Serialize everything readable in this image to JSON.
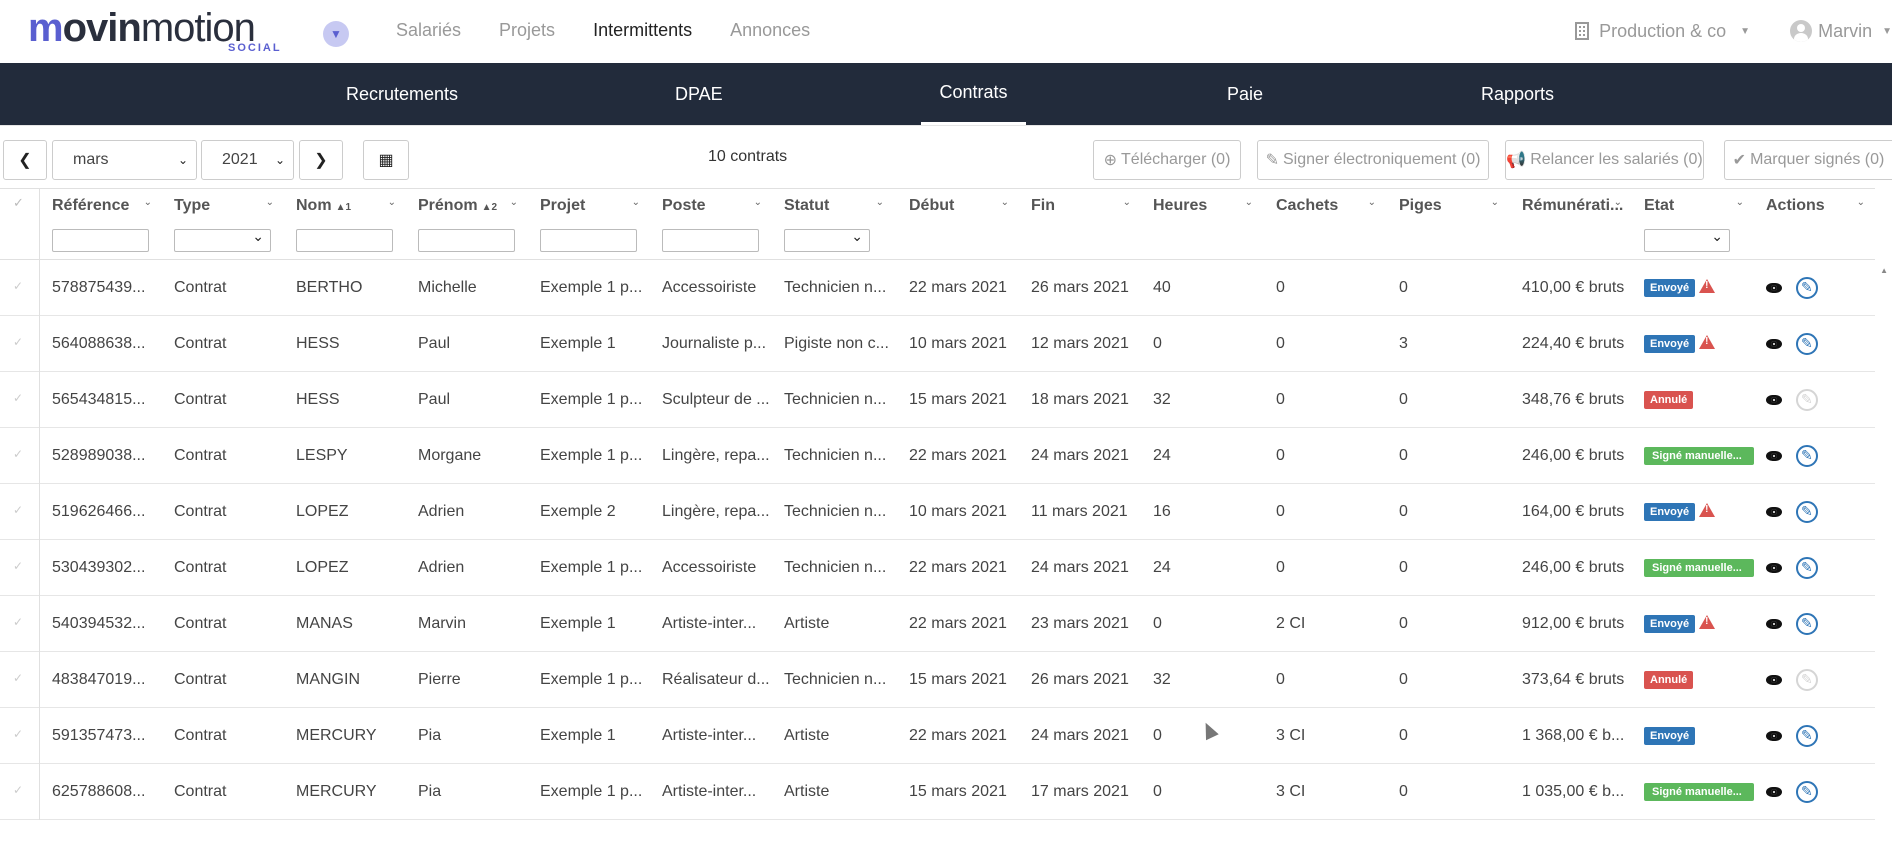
{
  "brand": {
    "logo_main": "movinmotion",
    "logo_sub": "SOCIAL"
  },
  "topnav": {
    "links": [
      "Salariés",
      "Projets",
      "Intermittents",
      "Annonces"
    ],
    "active": "Intermittents",
    "company": "Production & co",
    "user": "Marvin"
  },
  "subnav": {
    "tabs": [
      "Recrutements",
      "DPAE",
      "Contrats",
      "Paie",
      "Rapports"
    ],
    "active": "Contrats"
  },
  "toolbar": {
    "month": "mars",
    "year": "2021",
    "count": "10 contrats",
    "download": "Télécharger (0)",
    "sign": "Signer électroniquement (0)",
    "remind": "Relancer les salariés (0)",
    "mark_signed": "Marquer signés (0)"
  },
  "table": {
    "columns": [
      "Référence",
      "Type",
      "Nom",
      "Prénom",
      "Projet",
      "Poste",
      "Statut",
      "Début",
      "Fin",
      "Heures",
      "Cachets",
      "Piges",
      "Rémunérati...",
      "Etat",
      "Actions"
    ],
    "sort": {
      "nom": "1",
      "prenom": "2"
    },
    "rows": [
      {
        "ref": "578875439...",
        "type": "Contrat",
        "nom": "BERTHO",
        "prenom": "Michelle",
        "projet": "Exemple 1 p...",
        "poste": "Accessoiriste",
        "statut": "Technicien n...",
        "debut": "22 mars 2021",
        "fin": "26 mars 2021",
        "heures": "40",
        "cachets": "0",
        "piges": "0",
        "remu": "410,00 € bruts",
        "etat": "Envoyé",
        "etat_type": "envoye",
        "warn": true,
        "edit_enabled": true
      },
      {
        "ref": "564088638...",
        "type": "Contrat",
        "nom": "HESS",
        "prenom": "Paul",
        "projet": "Exemple 1",
        "poste": "Journaliste p...",
        "statut": "Pigiste non c...",
        "debut": "10 mars 2021",
        "fin": "12 mars 2021",
        "heures": "0",
        "cachets": "0",
        "piges": "3",
        "remu": "224,40 € bruts",
        "etat": "Envoyé",
        "etat_type": "envoye",
        "warn": true,
        "edit_enabled": true
      },
      {
        "ref": "565434815...",
        "type": "Contrat",
        "nom": "HESS",
        "prenom": "Paul",
        "projet": "Exemple 1 p...",
        "poste": "Sculpteur de ...",
        "statut": "Technicien n...",
        "debut": "15 mars 2021",
        "fin": "18 mars 2021",
        "heures": "32",
        "cachets": "0",
        "piges": "0",
        "remu": "348,76 € bruts",
        "etat": "Annulé",
        "etat_type": "annule",
        "warn": false,
        "edit_enabled": false
      },
      {
        "ref": "528989038...",
        "type": "Contrat",
        "nom": "LESPY",
        "prenom": "Morgane",
        "projet": "Exemple 1 p...",
        "poste": "Lingère, repa...",
        "statut": "Technicien n...",
        "debut": "22 mars 2021",
        "fin": "24 mars 2021",
        "heures": "24",
        "cachets": "0",
        "piges": "0",
        "remu": "246,00 € bruts",
        "etat": "Signé manuelle...",
        "etat_type": "signe",
        "warn": false,
        "edit_enabled": true
      },
      {
        "ref": "519626466...",
        "type": "Contrat",
        "nom": "LOPEZ",
        "prenom": "Adrien",
        "projet": "Exemple 2",
        "poste": "Lingère, repa...",
        "statut": "Technicien n...",
        "debut": "10 mars 2021",
        "fin": "11 mars 2021",
        "heures": "16",
        "cachets": "0",
        "piges": "0",
        "remu": "164,00 € bruts",
        "etat": "Envoyé",
        "etat_type": "envoye",
        "warn": true,
        "edit_enabled": true
      },
      {
        "ref": "530439302...",
        "type": "Contrat",
        "nom": "LOPEZ",
        "prenom": "Adrien",
        "projet": "Exemple 1 p...",
        "poste": "Accessoiriste",
        "statut": "Technicien n...",
        "debut": "22 mars 2021",
        "fin": "24 mars 2021",
        "heures": "24",
        "cachets": "0",
        "piges": "0",
        "remu": "246,00 € bruts",
        "etat": "Signé manuelle...",
        "etat_type": "signe",
        "warn": false,
        "edit_enabled": true
      },
      {
        "ref": "540394532...",
        "type": "Contrat",
        "nom": "MANAS",
        "prenom": "Marvin",
        "projet": "Exemple 1",
        "poste": "Artiste-inter...",
        "statut": "Artiste",
        "debut": "22 mars 2021",
        "fin": "23 mars 2021",
        "heures": "0",
        "cachets": "2 CI",
        "piges": "0",
        "remu": "912,00 € bruts",
        "etat": "Envoyé",
        "etat_type": "envoye",
        "warn": true,
        "edit_enabled": true
      },
      {
        "ref": "483847019...",
        "type": "Contrat",
        "nom": "MANGIN",
        "prenom": "Pierre",
        "projet": "Exemple 1 p...",
        "poste": "Réalisateur d...",
        "statut": "Technicien n...",
        "debut": "15 mars 2021",
        "fin": "26 mars 2021",
        "heures": "32",
        "cachets": "0",
        "piges": "0",
        "remu": "373,64 € bruts",
        "etat": "Annulé",
        "etat_type": "annule",
        "warn": false,
        "edit_enabled": false
      },
      {
        "ref": "591357473...",
        "type": "Contrat",
        "nom": "MERCURY",
        "prenom": "Pia",
        "projet": "Exemple 1",
        "poste": "Artiste-inter...",
        "statut": "Artiste",
        "debut": "22 mars 2021",
        "fin": "24 mars 2021",
        "heures": "0",
        "cachets": "3 CI",
        "piges": "0",
        "remu": "1 368,00 € b...",
        "etat": "Envoyé",
        "etat_type": "envoye",
        "warn": false,
        "edit_enabled": true
      },
      {
        "ref": "625788608...",
        "type": "Contrat",
        "nom": "MERCURY",
        "prenom": "Pia",
        "projet": "Exemple 1 p...",
        "poste": "Artiste-inter...",
        "statut": "Artiste",
        "debut": "15 mars 2021",
        "fin": "17 mars 2021",
        "heures": "0",
        "cachets": "3 CI",
        "piges": "0",
        "remu": "1 035,00 € b...",
        "etat": "Signé manuelle...",
        "etat_type": "signe",
        "warn": false,
        "edit_enabled": true
      }
    ]
  },
  "colors": {
    "navy": "#222b3b",
    "envoye": "#2e75b6",
    "annule": "#d9534f",
    "signe": "#5cb85c",
    "brand": "#5a5fd0"
  }
}
